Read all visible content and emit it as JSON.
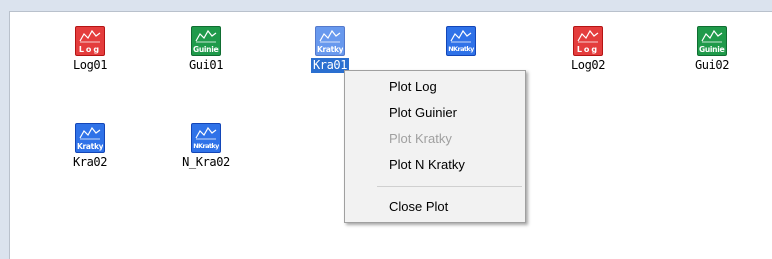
{
  "items": [
    {
      "label": "Log01",
      "icon_tag": "Log",
      "icon_kind": "log",
      "icon_name": "log-plot-icon",
      "selected": false
    },
    {
      "label": "Gui01",
      "icon_tag": "Guinier",
      "icon_kind": "guinier",
      "icon_name": "guinier-plot-icon",
      "selected": false
    },
    {
      "label": "Kra01",
      "icon_tag": "Kratky",
      "icon_kind": "kratky",
      "icon_name": "kratky-plot-icon",
      "selected": true
    },
    {
      "label": "",
      "icon_tag": "NKratky",
      "icon_kind": "nkratky",
      "icon_name": "nkratky-plot-icon",
      "selected": false
    },
    {
      "label": "Log02",
      "icon_tag": "Log",
      "icon_kind": "log",
      "icon_name": "log-plot-icon",
      "selected": false
    },
    {
      "label": "Gui02",
      "icon_tag": "Guinier",
      "icon_kind": "guinier",
      "icon_name": "guinier-plot-icon",
      "selected": false
    },
    {
      "label": "Kra02",
      "icon_tag": "Kratky",
      "icon_kind": "kratky",
      "icon_name": "kratky-plot-icon",
      "selected": false
    },
    {
      "label": "N_Kra02",
      "icon_tag": "NKratky",
      "icon_kind": "nkratky",
      "icon_name": "nkratky-plot-icon",
      "selected": false
    }
  ],
  "context_menu": {
    "items": [
      {
        "label": "Plot Log",
        "enabled": true
      },
      {
        "label": "Plot Guinier",
        "enabled": true
      },
      {
        "label": "Plot Kratky",
        "enabled": false
      },
      {
        "label": "Plot N Kratky",
        "enabled": true
      },
      {
        "label": "Close Plot",
        "enabled": true
      }
    ]
  },
  "colors": {
    "log": "#e43d3d",
    "guinier": "#1f9a4a",
    "kratky": "#2f72e8",
    "selection": "#2a6fd0"
  }
}
